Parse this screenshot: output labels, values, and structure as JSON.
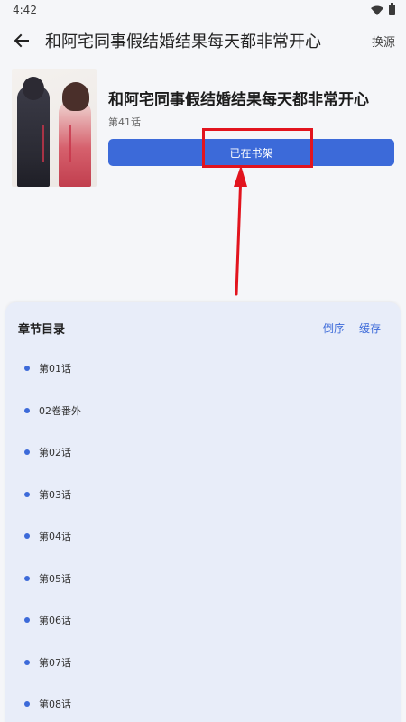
{
  "status_bar": {
    "time": "4:42"
  },
  "app_bar": {
    "title": "和阿宅同事假结婚结果每天都非常开心",
    "source_label": "换源"
  },
  "book": {
    "title": "和阿宅同事假结婚结果每天都非常开心",
    "latest_chapter": "第41话",
    "shelf_button_label": "已在书架"
  },
  "chapter_sheet": {
    "title": "章节目录",
    "reverse_label": "倒序",
    "cache_label": "缓存",
    "chapters": [
      {
        "label": "第01话"
      },
      {
        "label": "02卷番外"
      },
      {
        "label": "第02话"
      },
      {
        "label": "第03话"
      },
      {
        "label": "第04话"
      },
      {
        "label": "第05话"
      },
      {
        "label": "第06话"
      },
      {
        "label": "第07话"
      },
      {
        "label": "第08话"
      }
    ]
  },
  "colors": {
    "accent": "#3c6ad9",
    "annotation": "#e2141e",
    "sheet_bg": "#e8edf9"
  }
}
